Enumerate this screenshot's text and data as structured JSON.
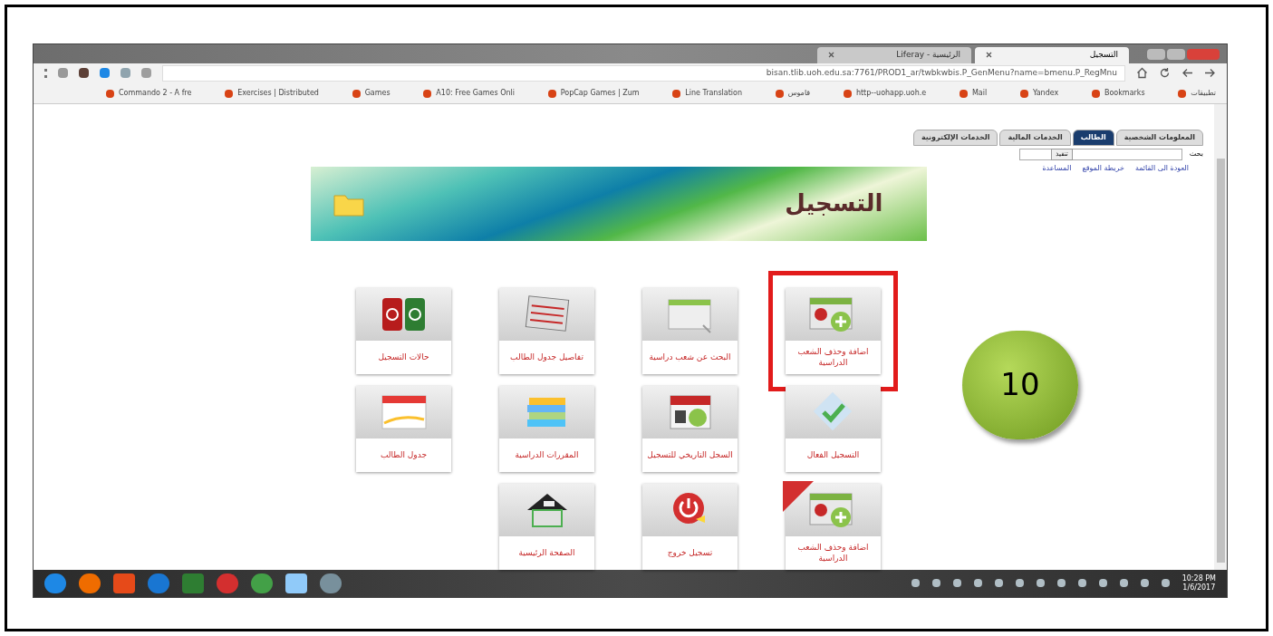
{
  "browser": {
    "tabs": [
      {
        "label": "التسجيل",
        "selected": true
      },
      {
        "label": "الرئيسية - Liferay",
        "selected": false
      }
    ],
    "url": "bisan.tlib.uoh.edu.sa:7761/PROD1_ar/twbkwbis.P_GenMenu?name=bmenu.P_RegMnu",
    "bookmarks": [
      "تطبيقات",
      "Bookmarks",
      "Yandex",
      "Mail",
      "http--uohapp.uoh.e",
      "قاموس",
      "Line Translation",
      "PopCap Games | Zum",
      "A10: Free Games Onli",
      "Games",
      "Exercises | Distributed",
      "Commando 2 - A fre"
    ]
  },
  "page": {
    "tabs": [
      {
        "label": "المعلومات الشخصية",
        "selected": false
      },
      {
        "label": "الطالب",
        "selected": true
      },
      {
        "label": "الخدمات المالية",
        "selected": false
      },
      {
        "label": "الخدمات الإلكترونية",
        "selected": false
      }
    ],
    "search_label": "بحث",
    "search_button": "تنفيذ",
    "links": [
      "العودة الى القائمة",
      "خريطة الموقع",
      "المساعدة"
    ],
    "banner_title": "التسجيل",
    "tiles": [
      {
        "kind": "add-drop",
        "label": "اضافة وحذف الشعب الدراسية",
        "selected": true,
        "new": false
      },
      {
        "kind": "search",
        "label": "البحث عن شعب دراسية",
        "selected": false,
        "new": false
      },
      {
        "kind": "timetable",
        "label": "تفاصيل جدول الطالب",
        "selected": false,
        "new": false
      },
      {
        "kind": "status",
        "label": "حالات التسجيل",
        "selected": false,
        "new": false
      },
      {
        "kind": "check",
        "label": "التسجيل الفعال",
        "selected": false,
        "new": false
      },
      {
        "kind": "history",
        "label": "السجل التاريخي للتسجيل",
        "selected": false,
        "new": false
      },
      {
        "kind": "books",
        "label": "المقررات الدراسية",
        "selected": false,
        "new": false
      },
      {
        "kind": "calendar",
        "label": "جدول الطالب",
        "selected": false,
        "new": false
      },
      {
        "kind": "add-drop",
        "label": "اضافة وحذف الشعب الدراسية",
        "selected": false,
        "new": true
      },
      {
        "kind": "power",
        "label": "تسجيل خروج",
        "selected": false,
        "new": false
      },
      {
        "kind": "house",
        "label": "الصفحة الرئيسية",
        "selected": false,
        "new": false
      }
    ]
  },
  "annotation": "10",
  "taskbar": {
    "time": "10:28 PM",
    "date": "1/6/2017"
  }
}
